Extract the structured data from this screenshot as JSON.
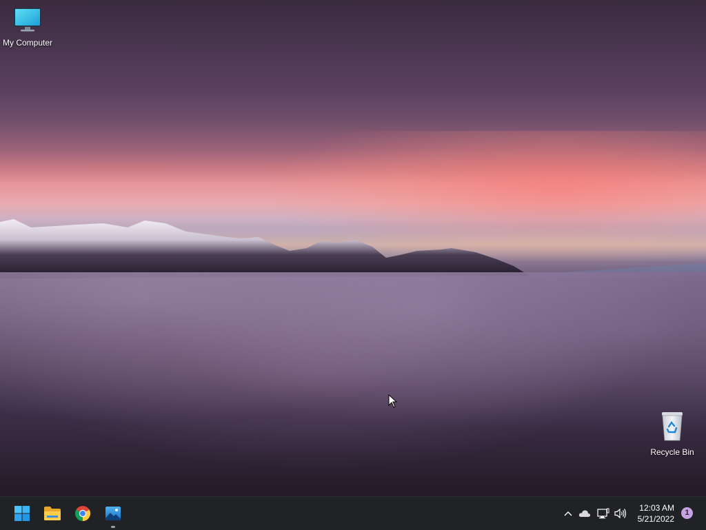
{
  "desktop": {
    "icons": [
      {
        "label": "My Computer",
        "icon": "monitor-icon"
      },
      {
        "label": "Recycle Bin",
        "icon": "recycle-bin-icon"
      }
    ]
  },
  "taskbar": {
    "apps": [
      {
        "name": "Start",
        "icon": "windows-start-icon"
      },
      {
        "name": "File Explorer",
        "icon": "folder-icon"
      },
      {
        "name": "Google Chrome",
        "icon": "chrome-icon"
      },
      {
        "name": "Photos",
        "icon": "photos-icon",
        "active": true
      }
    ],
    "tray": {
      "icons": [
        "chevron-up-icon",
        "onedrive-cloud-icon",
        "network-icon",
        "volume-icon"
      ],
      "time": "12:03 AM",
      "date": "5/21/2022",
      "notification_count": "1"
    }
  },
  "colors": {
    "taskbar_bg": "#202225",
    "accent": "#c7a2e0"
  }
}
